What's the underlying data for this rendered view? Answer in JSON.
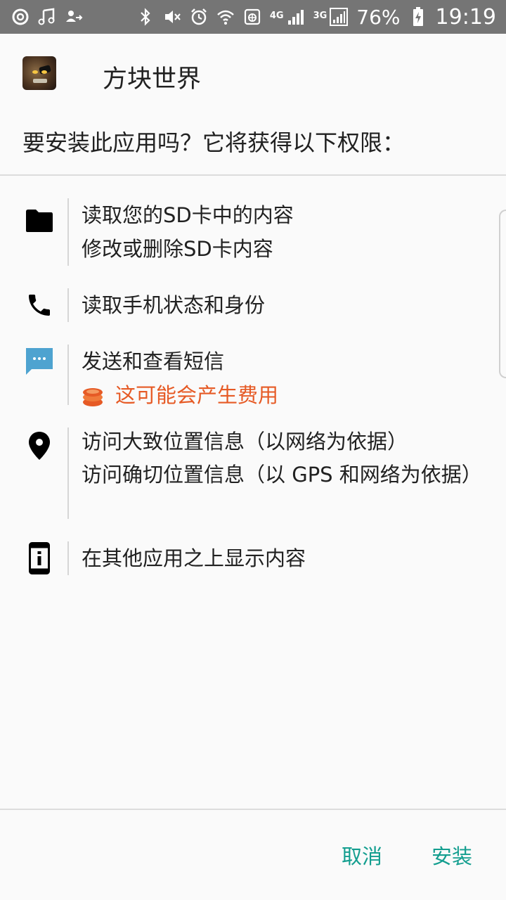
{
  "status_bar": {
    "network_4g": "4G",
    "network_3g": "3G",
    "battery": "76%",
    "time": "19:19"
  },
  "app": {
    "name": "方块世界"
  },
  "question": "要安装此应用吗？它将获得以下权限：",
  "permissions": [
    {
      "icon": "folder-icon",
      "lines": [
        "读取您的SD卡中的内容",
        "修改或删除SD卡内容"
      ]
    },
    {
      "icon": "phone-icon",
      "lines": [
        "读取手机状态和身份"
      ]
    },
    {
      "icon": "message-icon",
      "lines": [
        "发送和查看短信"
      ],
      "warning": "这可能会产生费用"
    },
    {
      "icon": "location-pin-icon",
      "lines": [
        "访问大致位置信息（以网络为依据）",
        "访问确切位置信息（以 GPS 和网络为依据）"
      ]
    },
    {
      "icon": "overlay-icon",
      "lines": [
        "在其他应用之上显示内容"
      ]
    }
  ],
  "colors": {
    "accent": "#139e8f",
    "warning": "#e65a25",
    "status_bar": "#757575",
    "message_icon": "#4ea3d0"
  },
  "buttons": {
    "cancel": "取消",
    "install": "安装"
  }
}
